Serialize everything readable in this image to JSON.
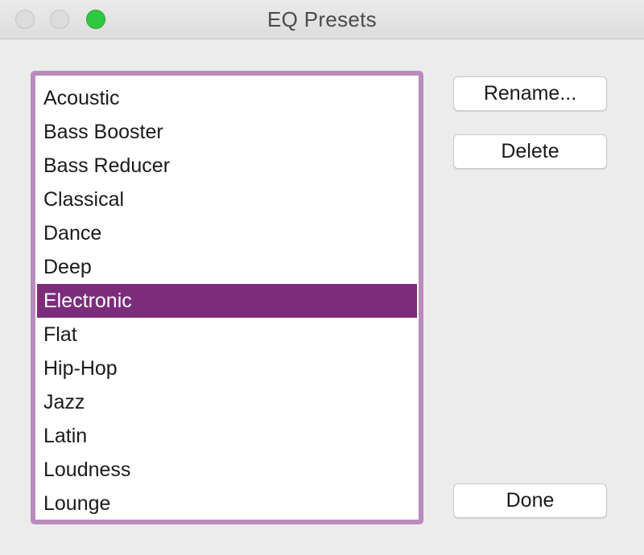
{
  "window": {
    "title": "EQ Presets"
  },
  "presets": [
    {
      "label": "Acoustic"
    },
    {
      "label": "Bass Booster"
    },
    {
      "label": "Bass Reducer"
    },
    {
      "label": "Classical"
    },
    {
      "label": "Dance"
    },
    {
      "label": "Deep"
    },
    {
      "label": "Electronic",
      "selected": true
    },
    {
      "label": "Flat"
    },
    {
      "label": "Hip-Hop"
    },
    {
      "label": "Jazz"
    },
    {
      "label": "Latin"
    },
    {
      "label": "Loudness"
    },
    {
      "label": "Lounge"
    }
  ],
  "buttons": {
    "rename": "Rename...",
    "delete": "Delete",
    "done": "Done"
  },
  "colors": {
    "selection": "#7b2d7b",
    "focus_ring": "#b98cbd",
    "zoom_button": "#2fc840"
  }
}
